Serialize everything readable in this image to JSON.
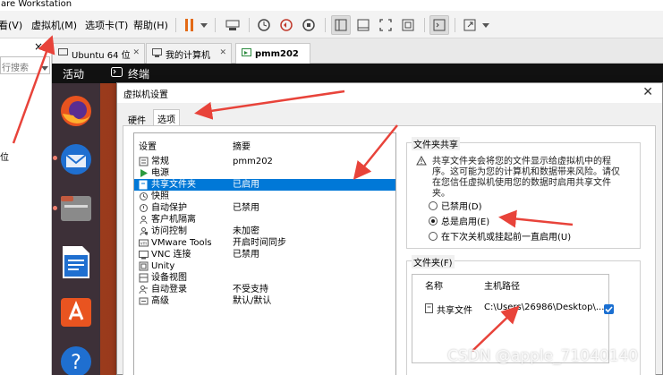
{
  "window": {
    "title": "are Workstation"
  },
  "menu": {
    "items": [
      {
        "label": "看(V)"
      },
      {
        "label": "虚拟机(M)"
      },
      {
        "label": "选项卡(T)"
      },
      {
        "label": "帮助(H)"
      }
    ]
  },
  "toolbar": {
    "icons": [
      "pause-icon",
      "dropdown-icon",
      "send-keys-icon",
      "snapshot-icon",
      "revert-snapshot-icon",
      "snapshot-manager-icon",
      "sidebar-view-icon",
      "thumbnail-view-icon",
      "fullscreen-icon",
      "unity-icon",
      "console-view-icon",
      "stretch-icon",
      "dropdown-icon"
    ]
  },
  "library": {
    "close_glyph": "×",
    "search_placeholder": "行搜索",
    "item_partial": "位"
  },
  "vm_tabs": [
    {
      "label": "Ubuntu 64 位",
      "active": false
    },
    {
      "label": "我的计算机",
      "active": false
    },
    {
      "label": "pmm202",
      "active": true
    }
  ],
  "guest": {
    "activities": "活动",
    "terminal": "终端",
    "dock": [
      "firefox-icon",
      "thunderbird-icon",
      "files-icon",
      "writer-icon",
      "software-icon",
      "help-icon"
    ]
  },
  "dialog": {
    "title": "虚拟机设置",
    "close": "✕",
    "tabs": [
      {
        "label": "硬件"
      },
      {
        "label": "选项",
        "active": true
      }
    ],
    "list_header": {
      "setting": "设置",
      "summary": "摘要"
    },
    "settings": [
      {
        "name": "常规",
        "summary": "pmm202",
        "icon": "general-icon"
      },
      {
        "name": "电源",
        "summary": "",
        "icon": "power-icon"
      },
      {
        "name": "共享文件夹",
        "summary": "已启用",
        "icon": "shared-folder-icon",
        "selected": true
      },
      {
        "name": "快照",
        "summary": "",
        "icon": "snapshot-icon"
      },
      {
        "name": "自动保护",
        "summary": "已禁用",
        "icon": "autoprotect-icon"
      },
      {
        "name": "客户机隔离",
        "summary": "",
        "icon": "guest-isolation-icon"
      },
      {
        "name": "访问控制",
        "summary": "未加密",
        "icon": "access-control-icon"
      },
      {
        "name": "VMware Tools",
        "summary": "开启时间同步",
        "icon": "vmware-tools-icon"
      },
      {
        "name": "VNC 连接",
        "summary": "已禁用",
        "icon": "vnc-icon"
      },
      {
        "name": "Unity",
        "summary": "",
        "icon": "unity-icon"
      },
      {
        "name": "设备视图",
        "summary": "",
        "icon": "device-view-icon"
      },
      {
        "name": "自动登录",
        "summary": "不受支持",
        "icon": "autologin-icon"
      },
      {
        "name": "高级",
        "summary": "默认/默认",
        "icon": "advanced-icon"
      }
    ],
    "sharing": {
      "title": "文件夹共享",
      "warning": "共享文件夹会将您的文件显示给虚拟机中的程序。这可能为您的计算机和数据带来风险。请仅在您信任虚拟机使用您的数据时启用共享文件夹。",
      "options": [
        {
          "label": "已禁用(D)",
          "checked": false
        },
        {
          "label": "总是启用(E)",
          "checked": true
        },
        {
          "label": "在下次关机或挂起前一直启用(U)",
          "checked": false
        }
      ]
    },
    "folders": {
      "title": "文件夹(F)",
      "col_name": "名称",
      "col_path": "主机路径",
      "rows": [
        {
          "name": "共享文件",
          "path": "C:\\Users\\26986\\Desktop\\...",
          "enabled": true
        }
      ]
    }
  },
  "watermark": "CSDN @apple_71040140",
  "colors": {
    "selection": "#0078d7",
    "annotation_arrow": "#e8433a",
    "ubuntu_dock": "#3d3038"
  }
}
